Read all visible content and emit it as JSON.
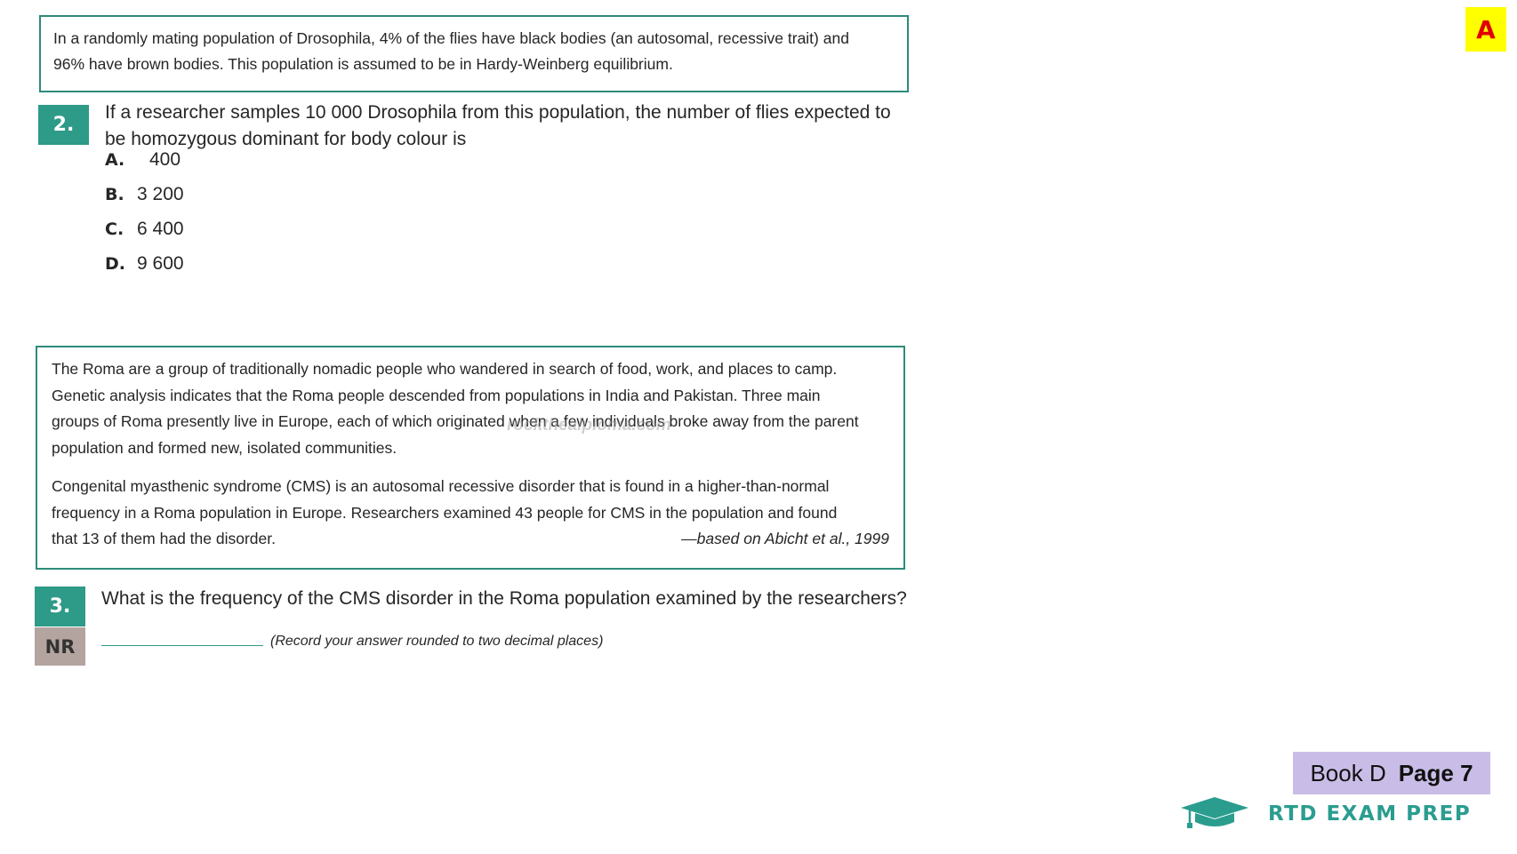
{
  "passage1": {
    "line1": "In a randomly mating population of Drosophila, 4% of the flies have black bodies (an autosomal, recessive trait) and",
    "line2": "96% have brown bodies.  This population is assumed to be in Hardy-Weinberg equilibrium."
  },
  "question2": {
    "number": "2.",
    "stem_line1": "If a researcher samples 10 000 Drosophila from this population, the number of flies expected to",
    "stem_line2": "be homozygous dominant for body colour is",
    "options": [
      {
        "letter": "A.",
        "value": "400"
      },
      {
        "letter": "B.",
        "value": "3 200"
      },
      {
        "letter": "C.",
        "value": "6 400"
      },
      {
        "letter": "D.",
        "value": "9 600"
      }
    ]
  },
  "passage2": {
    "para1_lines": [
      "The Roma are a group of traditionally nomadic people who wandered in search of food, work, and places to camp.",
      "Genetic analysis indicates that the Roma people descended from populations in India and Pakistan. Three main",
      "groups of Roma presently live in Europe, each of which originated when a few individuals broke away from the parent",
      "population and formed new, isolated communities."
    ],
    "para2_lines": [
      "Congenital myasthenic syndrome (CMS) is an autosomal recessive disorder that is found in a higher-than-normal",
      "frequency in a Roma population in Europe. Researchers examined 43 people for CMS in the population and found",
      "that 13 of them had the disorder."
    ],
    "citation": "—based on Abicht et al., 1999"
  },
  "question3": {
    "number": "3.",
    "type_badge": "NR",
    "stem": "What is the frequency of the CMS disorder in the Roma population examined by the researchers?",
    "instruction": "(Record your answer rounded to two decimal places)"
  },
  "watermark": "rocktheaiploma.com",
  "answer_badge": "A",
  "page_tag": {
    "book": "Book D",
    "page": "Page 7"
  },
  "brand": {
    "name": "RTD EXAM PREP",
    "icon": "graduation-cap-icon",
    "color": "#2a9d8f"
  },
  "colors": {
    "accent": "#2e9a88",
    "nr_badge": "#b3a49f",
    "answer_bg": "#ffff00",
    "answer_text": "#e00000",
    "page_tag_bg": "#c9bde8"
  }
}
